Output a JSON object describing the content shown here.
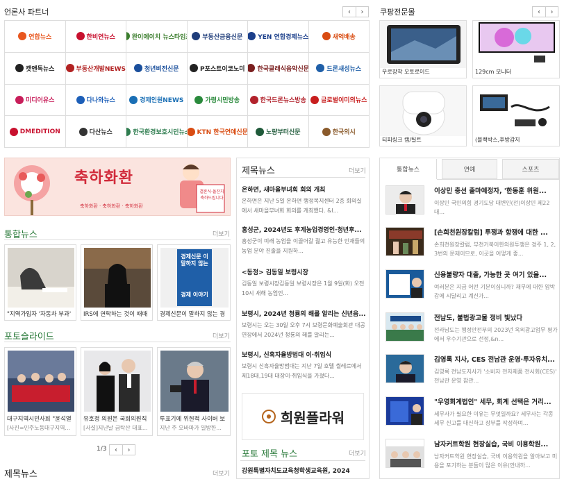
{
  "partners": {
    "title": "언론사 파트너",
    "prev": "‹",
    "next": "›",
    "logos": [
      {
        "text": "연합뉴스",
        "color": "#e8571f"
      },
      {
        "text": "한비연뉴스",
        "color": "#c8102e"
      },
      {
        "text": "완이에이치 뉴스타임즈",
        "color": "#3a7d2c"
      },
      {
        "text": "부동산금융신문",
        "color": "#1f3d7a"
      },
      {
        "text": "YEN 연합경제뉴스",
        "color": "#1b3f8b"
      },
      {
        "text": "새억배송",
        "color": "#d94c12"
      },
      {
        "text": "캣앤독뉴스",
        "color": "#222222"
      },
      {
        "text": "부동산개발NEWS",
        "color": "#b22222"
      },
      {
        "text": "청년비전신문",
        "color": "#1a4f9c"
      },
      {
        "text": "P포스트이코노미",
        "color": "#222222"
      },
      {
        "text": "한국클래식음악신문",
        "color": "#7a1f1f"
      },
      {
        "text": "드론새성뉴스",
        "color": "#1f5fa8"
      },
      {
        "text": "미디어유스",
        "color": "#c81e5a"
      },
      {
        "text": "다나와뉴스",
        "color": "#1d5fb8"
      },
      {
        "text": "경제인원NEWS",
        "color": "#1a6fb5"
      },
      {
        "text": "가령시민방송",
        "color": "#2a8a3c"
      },
      {
        "text": "한국드론뉴스방송",
        "color": "#b2222c"
      },
      {
        "text": "글로벌이미의뉴스",
        "color": "#c81e1e"
      },
      {
        "text": "DMEDITION",
        "color": "#c8102e"
      },
      {
        "text": "다산뉴스",
        "color": "#333333"
      },
      {
        "text": "한국환경보호시민뉴스",
        "color": "#2e7d4f"
      },
      {
        "text": "KTN 한국연예신문",
        "color": "#d94c12"
      },
      {
        "text": "노량부터신문",
        "color": "#1f5a3a"
      },
      {
        "text": "한국의시",
        "color": "#8a5a2b"
      }
    ]
  },
  "coupang": {
    "title": "쿠팡전문몰",
    "prev": "‹",
    "next": "›",
    "items": [
      {
        "label": "우로장착 오토로이드"
      },
      {
        "label": "129cm 모니터"
      },
      {
        "label": "티피링크 캠/틸트"
      },
      {
        "label": "(블랙박스,후방감지"
      }
    ]
  },
  "banner": {
    "text": "축하화환",
    "sign": "결혼식·돌잔치 축하드립니다",
    "sub": "축하화환 · 축하화환 · 축하화환"
  },
  "integrated": {
    "title": "통합뉴스",
    "more": "더보기",
    "items": [
      {
        "caption": "\"지역가입자 '자동차 부과'"
      },
      {
        "caption": "IRS에 연락하는 것이 때때"
      },
      {
        "caption": "경제신문이 말하지 않는 경",
        "book_title": "경제신문 이 말하지 않는",
        "book_sub": "경제 이야기"
      }
    ]
  },
  "photo_slide": {
    "title": "포토슬라이드",
    "more": "더보기",
    "items": [
      {
        "caption": "대구지역시민사회 \"윤석열",
        "sub": "[사진=민주노동대구지역..."
      },
      {
        "caption": "유호정 의원은 국회의원직",
        "sub": "[사설]지난날 금탁산 대표..."
      },
      {
        "caption": "투표기에 위헌적 사이버 보",
        "sub": "지난 주 오바마가 일방한..."
      }
    ],
    "page": "1/3",
    "prev": "‹",
    "next": "›"
  },
  "title_news_bottom": {
    "title": "제목뉴스",
    "more": "더보기"
  },
  "title_news": {
    "title": "제목뉴스",
    "more": "더보기",
    "items": [
      {
        "title": "온하면, 새마을부녀회 회의 개최",
        "desc": "온하면은 지난 5일 온하면 행정복지센터 2층 회의실에서 새마을부녀회 회의를 개최했다. &l..."
      },
      {
        "title": "홍성군, 2024년도 후계농업경영인·청년후...",
        "desc": "홍성군이 미래 농업을 이끌어갈 젊고 유능한 인재들의 농업 분야 진출을 지원하..."
      },
      {
        "title": "<동정> 김동일 보령시장",
        "desc": "김동일 보령시장김동일 보령시장은 1월 9일(화) 오전 10시 새해 농업인..."
      },
      {
        "title": "보령시, 2024년 청룡의 해를 알리는 신년음...",
        "desc": "보령시는 오는 30일 오후 7시 보령문화예술회관 대공연장에서 2024년 청룡의 해를 알리는..."
      },
      {
        "title": "보령시, 신흑자율방범대 이·취임식",
        "desc": "보령시 신흑자율방범대는 지난 7일 호텔 썰레르에서 제18대,19대 대장이·취임식을 가졌다..."
      }
    ]
  },
  "ad": {
    "text": "희원플라워"
  },
  "photo_title_news": {
    "title": "포토 제목 뉴스",
    "more": "더보기",
    "first": "강원특별자치도교육청학생교육원, 2024"
  },
  "tabs": {
    "items": [
      "통합뉴스",
      "연예",
      "스포츠"
    ],
    "active": 0
  },
  "right_news": [
    {
      "title": "이상민 충선 출마예정자, '한동훈 위원...",
      "desc": "이상민 국민의힘 경기도당 대변인(전)이상민 제22대..."
    },
    {
      "title": "[손희천원장칼럼] 투쟁과 항쟁에 대한 ...",
      "desc": "손희천원장칼럼, 부천거북이한의원투쟁은 경주 1, 2, 3번의 문제이므로, 이곳을 어떻게 좋..."
    },
    {
      "title": "신용불량자 대출, 가능한 곳 여기 있을...",
      "desc": "여러분은 지금 어떤 기분이십니까? 채무에 대한 압박감에 시달리고 계신가..."
    },
    {
      "title": "전남도, 불법광고물 정비 빛났다",
      "desc": "전라남도는 행정안전부의 2023년 옥외광고업무 평가에서 우수기관으로 선정,&n..."
    },
    {
      "title": "김영록 지사, CES 전남관 운영·투자유치...",
      "desc": "김영록 전남도지사가 '소비자 전자제품 전시회(CES)' 전남관 운영 참관..."
    },
    {
      "title": "\"우영회계법인\" 세무, 회계 선택은 거리...",
      "desc": "세무사가 필요한 이유는 무엇일까요? 세무사는 각종 세무 신고를 대신하고 장부를 작성하며..."
    },
    {
      "title": "남자커트학원 현장실습, 국비 이용학원...",
      "desc": "남자커트학원 현장실습, 국비 이용학원을 알아보고 미용을 포기하는 분들이 많은 이유(안내하..."
    }
  ]
}
